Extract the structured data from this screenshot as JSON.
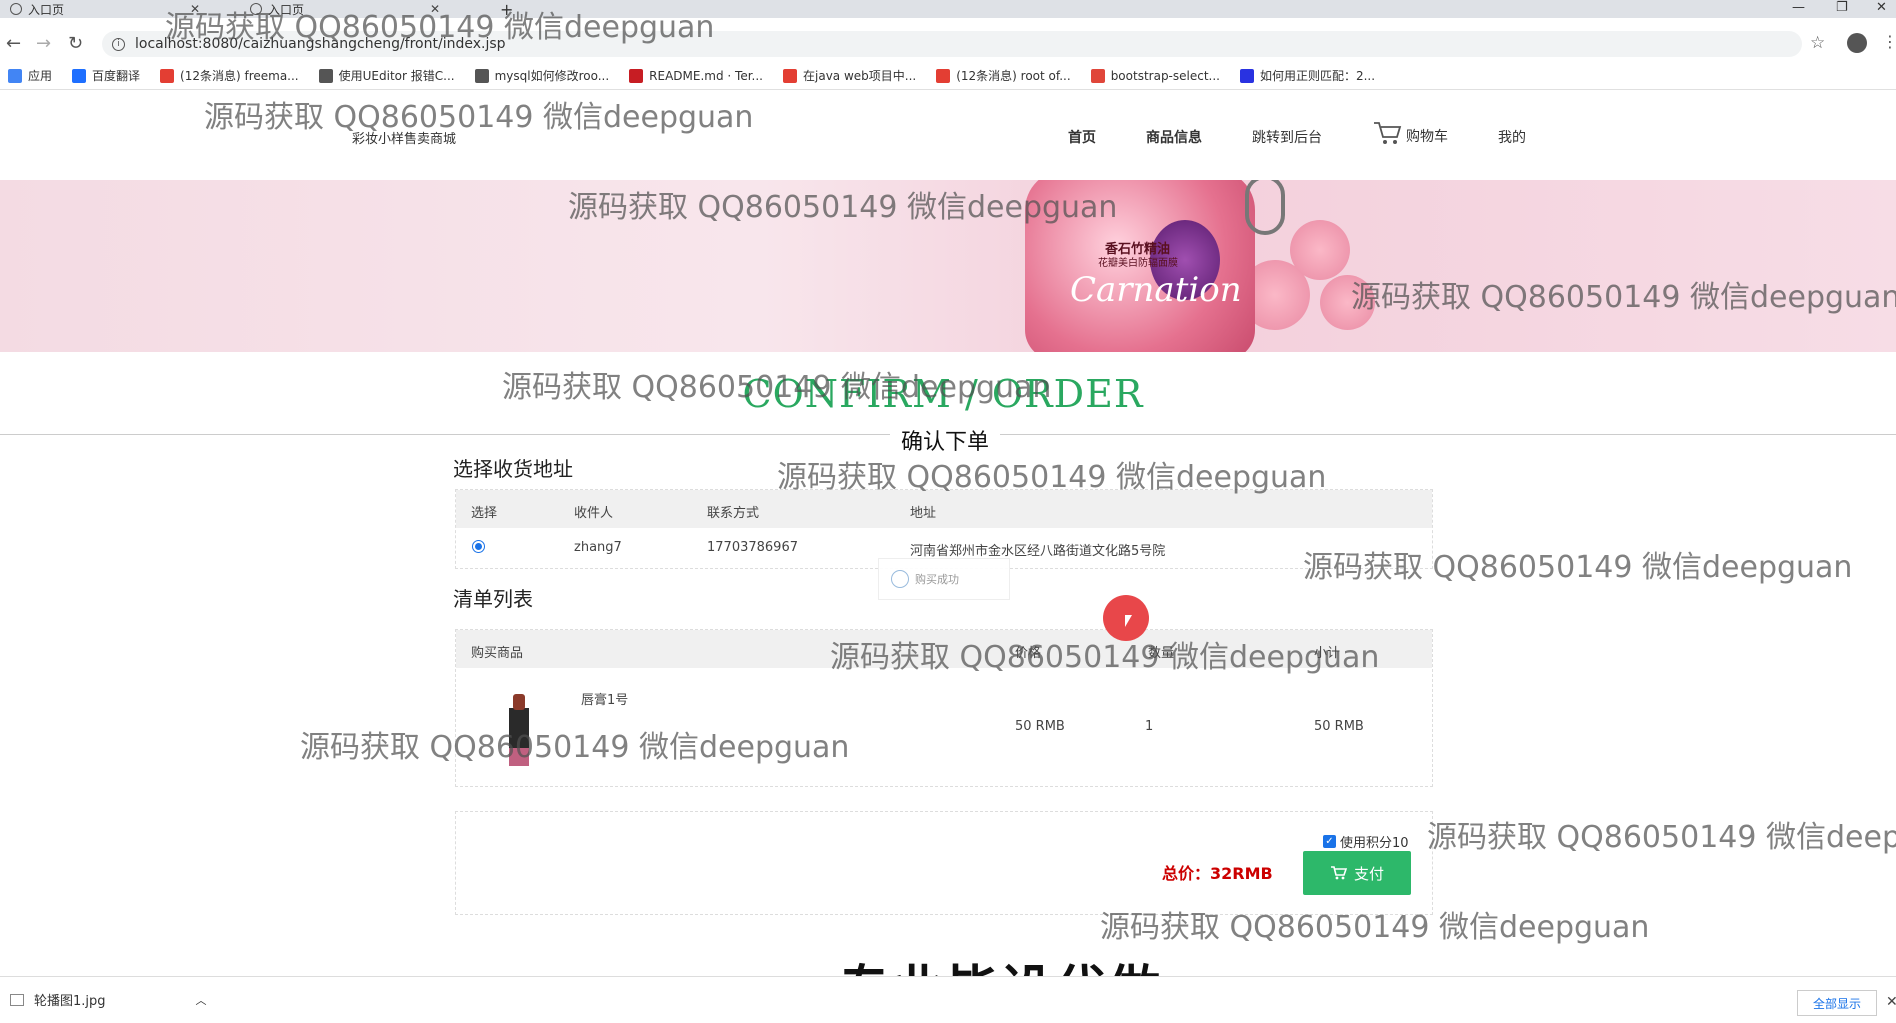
{
  "browser": {
    "tabs": [
      {
        "label": "入口页"
      },
      {
        "label": "入口页"
      }
    ],
    "new_tab": "+",
    "url": "localhost:8080/caizhuangshangcheng/front/index.jsp",
    "bookmarks": [
      {
        "label": "应用",
        "icon": "apps-grid-icon",
        "color": "#4285f4"
      },
      {
        "label": "百度翻译",
        "icon": "baidu-translate-icon",
        "color": "#1e6fff"
      },
      {
        "label": "(12条消息) freema...",
        "icon": "csdn-icon",
        "color": "#e33e33"
      },
      {
        "label": "使用UEditor 报错C...",
        "icon": "page-icon",
        "color": "#555555"
      },
      {
        "label": "mysql如何修改roo...",
        "icon": "page-icon",
        "color": "#555555"
      },
      {
        "label": "README.md · Ter...",
        "icon": "gitee-icon",
        "color": "#c71d23"
      },
      {
        "label": "在java web项目中...",
        "icon": "csdn-icon",
        "color": "#e33e33"
      },
      {
        "label": "(12条消息) root of...",
        "icon": "csdn-icon",
        "color": "#e33e33"
      },
      {
        "label": "bootstrap-select...",
        "icon": "bookmark-site-icon",
        "color": "#e0463a"
      },
      {
        "label": "如何用正则匹配：2...",
        "icon": "baidu-paw-icon",
        "color": "#2932e1"
      }
    ]
  },
  "site": {
    "name": "彩妆小样售卖商城",
    "nav": [
      {
        "label": "首页",
        "bold": true
      },
      {
        "label": "商品信息",
        "bold": true
      },
      {
        "label": "跳转到后台",
        "bold": false
      },
      {
        "label": "购物车",
        "bold": false,
        "icon": "cart-icon"
      },
      {
        "label": "我的",
        "bold": false
      }
    ]
  },
  "banner": {
    "product_title": "香石竹精油",
    "product_subtitle": "花瓣美白防辐面膜",
    "brand_script": "Carnation"
  },
  "page": {
    "title_en": "CONFIRM / ORDER",
    "title_cn": "确认下单"
  },
  "address": {
    "heading": "选择收货地址",
    "columns": [
      "选择",
      "收件人",
      "联系方式",
      "地址"
    ],
    "rows": [
      {
        "selected": true,
        "recipient": "zhang7",
        "phone": "17703786967",
        "address": "河南省郑州市金水区经八路街道文化路5号院"
      }
    ]
  },
  "toast": {
    "text": "购买成功"
  },
  "order": {
    "heading": "清单列表",
    "columns": [
      "购买商品",
      "价格",
      "数量",
      "小计"
    ],
    "items": [
      {
        "name": "唇膏1号",
        "price": "50 RMB",
        "qty": "1",
        "subtotal": "50 RMB"
      }
    ]
  },
  "payment": {
    "points_label": "使用积分10",
    "points_checked": true,
    "total_label": "总价：32RMB",
    "pay_label": "支付",
    "accent": "#2db86a"
  },
  "watermark": "源码获取 QQ86050149 微信deepguan",
  "caption": "专业毕设代做",
  "downloads": {
    "file": "轮播图1.jpg",
    "show_all": "全部显示"
  }
}
